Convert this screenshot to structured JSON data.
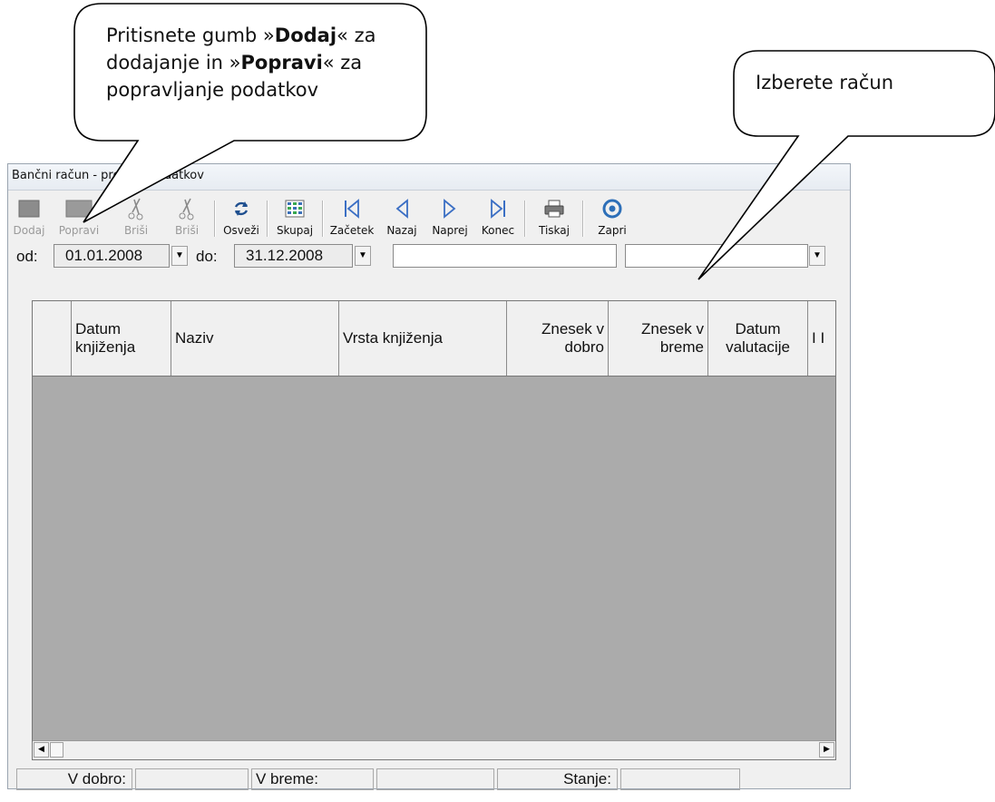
{
  "callouts": {
    "left": {
      "text_parts": [
        "Pritisnete gumb »",
        "Dodaj",
        "« za dodajanje in »",
        "Popravi",
        "« za popravljanje podatkov"
      ]
    },
    "right": {
      "text": "Izberete račun"
    }
  },
  "window": {
    "title": "Bančni račun - pregled podatkov"
  },
  "toolbar": {
    "buttons": [
      {
        "label": "Dodaj",
        "icon": "add-icon",
        "enabled": false
      },
      {
        "label": "Popravi",
        "icon": "edit-icon",
        "enabled": false
      },
      {
        "label": "Briši",
        "icon": "scissors-icon",
        "enabled": false
      },
      {
        "label": "Briši",
        "icon": "scissors-icon",
        "enabled": false
      },
      {
        "label": "Osveži",
        "icon": "refresh-icon",
        "enabled": true
      },
      {
        "label": "Skupaj",
        "icon": "summary-icon",
        "enabled": true
      },
      {
        "label": "Začetek",
        "icon": "first-icon",
        "enabled": true
      },
      {
        "label": "Nazaj",
        "icon": "previous-icon",
        "enabled": true
      },
      {
        "label": "Naprej",
        "icon": "next-icon",
        "enabled": true
      },
      {
        "label": "Konec",
        "icon": "last-icon",
        "enabled": true
      },
      {
        "label": "Tiskaj",
        "icon": "printer-icon",
        "enabled": true
      },
      {
        "label": "Zapri",
        "icon": "close-icon",
        "enabled": true
      }
    ]
  },
  "filters": {
    "from_label": "od:",
    "from_value": "01.01.2008",
    "to_label": "do:",
    "to_value": "31.12.2008",
    "search_value": "",
    "account_value": ""
  },
  "grid": {
    "columns": [
      "",
      "Datum knjiženja",
      "Naziv",
      "Vrsta knjiženja",
      "Znesek v dobro",
      "Znesek v breme",
      "Datum valutacije",
      "I I"
    ]
  },
  "status": {
    "credit_label": "V dobro:",
    "credit_value": "",
    "debit_label": "V breme:",
    "debit_value": "",
    "balance_label": "Stanje:",
    "balance_value": ""
  }
}
